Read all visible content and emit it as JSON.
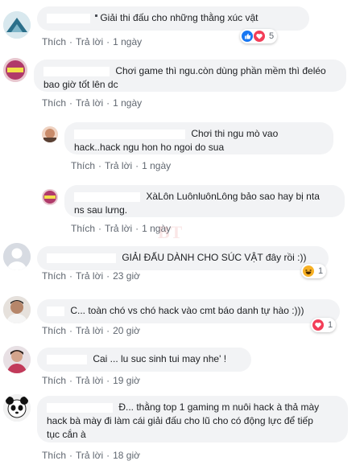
{
  "comments": [
    {
      "text": "Giải thi đấu cho những thằng xúc vật",
      "actions": {
        "like": "Thích",
        "reply": "Trả lời",
        "time": "1 ngày"
      },
      "reaction_count": "5",
      "reaction_icons": [
        "like-icon",
        "love-icon"
      ]
    },
    {
      "text_line1": "Chơi game thì ngu.còn dùng phần mềm thì đeléo",
      "text_line2": "bao giờ tốt lên dc",
      "actions": {
        "like": "Thích",
        "reply": "Trả lời",
        "time": "1 ngày"
      }
    },
    {
      "text_line1": "Chơi thi ngu mò vao",
      "text_line2": "hack..hack ngu hon ho ngoi do sua",
      "actions": {
        "like": "Thích",
        "reply": "Trả lời",
        "time": "1 ngày"
      }
    },
    {
      "text_line1": "XàLôn LuônluônLông bảo sao hay bị nta",
      "text_line2": "ns sau lưng.",
      "actions": {
        "like": "Thích",
        "reply": "Trả lời",
        "time": "1 ngày"
      }
    },
    {
      "text": "GIẢI ĐẤU DÀNH CHO SÚC VẬT đây rồi :))",
      "actions": {
        "like": "Thích",
        "reply": "Trả lời",
        "time": "23 giờ"
      },
      "reaction_count": "1",
      "reaction_icons": [
        "haha-icon"
      ]
    },
    {
      "text": "C... toàn chó vs chó hack vào cmt báo danh tự hào :)))",
      "actions": {
        "like": "Thích",
        "reply": "Trả lời",
        "time": "20 giờ"
      },
      "reaction_count": "1",
      "reaction_icons": [
        "love-icon"
      ]
    },
    {
      "text": "Cai ... lu suc sinh tui may nhe' !",
      "actions": {
        "like": "Thích",
        "reply": "Trả lời",
        "time": "19 giờ"
      }
    },
    {
      "text_line1": "Đ... thằng top 1 gaming m nuôi hack à thả mày",
      "text_line2": "hack bà mày đi làm cái giải đấu cho lũ cho có động lực để tiếp",
      "text_line3": "tục cắn à",
      "actions": {
        "like": "Thích",
        "reply": "Trả lời",
        "time": "18 giờ"
      }
    }
  ],
  "colors": {
    "bubble": "#f2f3f5",
    "action_text": "#606770",
    "like_blue": "#1877f2",
    "love_red": "#f33e58",
    "haha_yellow": "#f7b125"
  }
}
